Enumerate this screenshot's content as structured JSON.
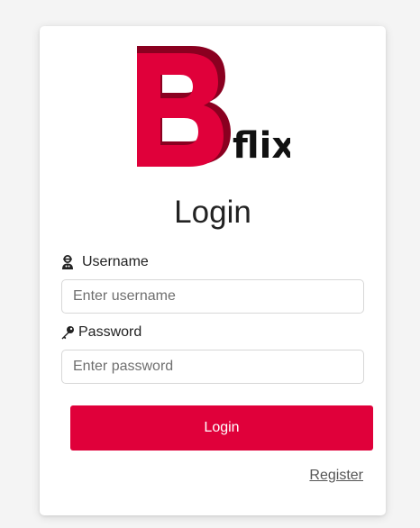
{
  "logo": {
    "letter": "B",
    "wordmark": "flix",
    "brand_color": "#e0003a",
    "shadow_color": "#8a0020"
  },
  "login_form": {
    "title": "Login",
    "username_label": "Username",
    "username_placeholder": "Enter username",
    "username_value": "",
    "username_icon": "user-icon",
    "password_label": "Password",
    "password_placeholder": "Enter password",
    "password_value": "",
    "password_icon": "key-icon",
    "submit_label": "Login",
    "register_link": "Register"
  },
  "colors": {
    "accent": "#e0003a",
    "background": "#f4f4f4",
    "card": "#ffffff"
  }
}
